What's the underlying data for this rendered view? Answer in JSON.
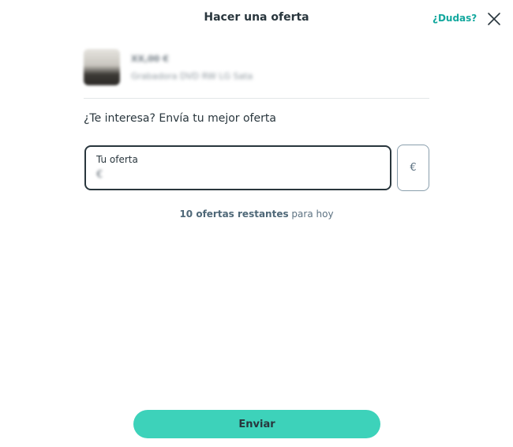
{
  "header": {
    "title": "Hacer una oferta",
    "help_label": "¿Dudas?",
    "close_icon": "close-icon"
  },
  "product": {
    "price": "XX,00 €",
    "name": "Grabadora DVD RW LG Sata"
  },
  "offer": {
    "prompt": "¿Te interesa? Envía tu mejor oferta",
    "field_label": "Tu oferta",
    "field_value": "€",
    "currency_label": "€"
  },
  "remaining": {
    "count_text": "10 ofertas restantes",
    "suffix_text": " para hoy"
  },
  "actions": {
    "send_label": "Enviar"
  },
  "colors": {
    "accent": "#3dd2ba",
    "link": "#13a89e",
    "text": "#29363d"
  }
}
